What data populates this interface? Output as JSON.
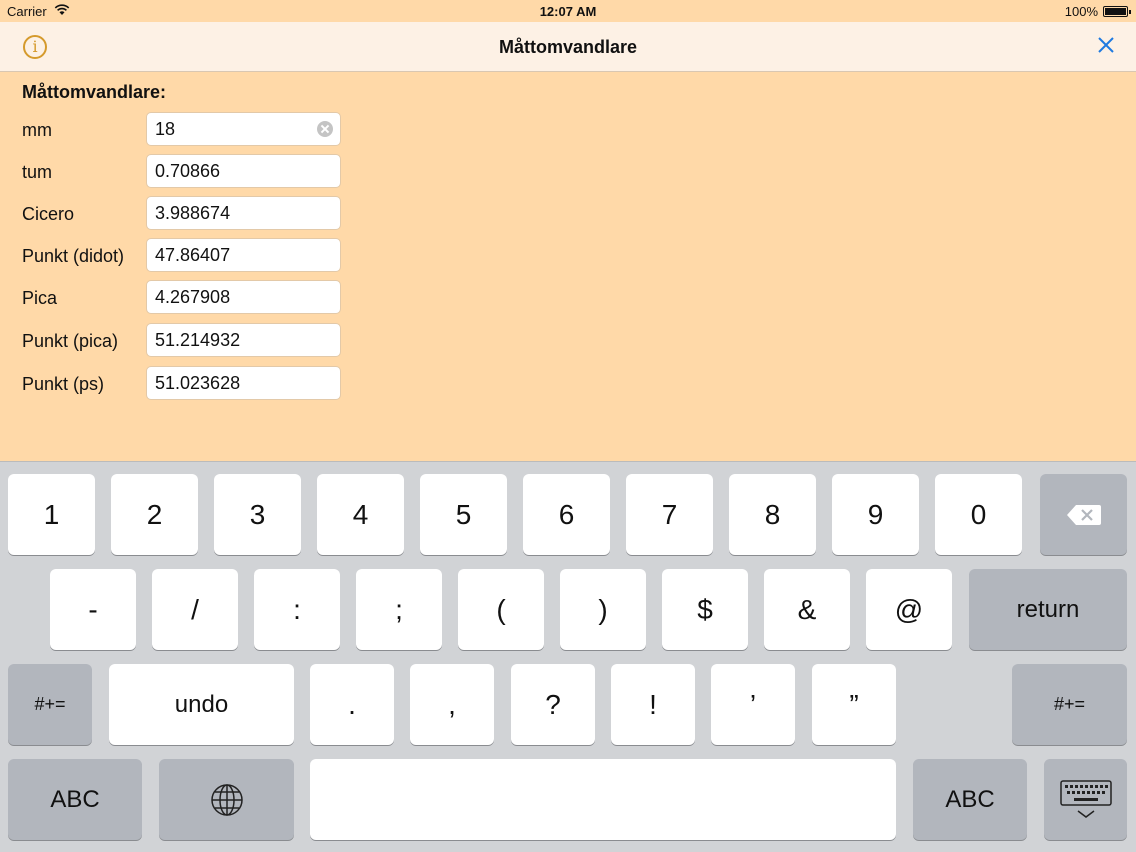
{
  "status_bar": {
    "carrier": "Carrier",
    "time": "12:07 AM",
    "battery": "100%"
  },
  "nav": {
    "title": "Måttomvandlare",
    "info_icon": "info-icon",
    "close_icon": "close-icon"
  },
  "form": {
    "title": "Måttomvandlare:",
    "rows": [
      {
        "label": "mm",
        "value": "18"
      },
      {
        "label": "tum",
        "value": "0.70866"
      },
      {
        "label": "Cicero",
        "value": "3.988674"
      },
      {
        "label": "Punkt (didot)",
        "value": "47.86407"
      },
      {
        "label": "Pica",
        "value": "4.267908"
      },
      {
        "label": "Punkt (pica)",
        "value": "51.214932"
      },
      {
        "label": "Punkt (ps)",
        "value": "51.023628"
      }
    ]
  },
  "keyboard": {
    "row1": [
      "1",
      "2",
      "3",
      "4",
      "5",
      "6",
      "7",
      "8",
      "9",
      "0"
    ],
    "row2": [
      "-",
      "/",
      ":",
      ";",
      "(",
      ")",
      "$",
      "&",
      "@"
    ],
    "return_label": "return",
    "row3": [
      ".",
      ",",
      "?",
      "!",
      "’",
      "”"
    ],
    "symbols_label": "#+=",
    "undo_label": "undo",
    "abc_label": "ABC",
    "icons": {
      "backspace": "backspace-icon",
      "globe": "globe-icon",
      "dismiss": "keyboard-dismiss-icon"
    }
  },
  "colors": {
    "background": "#ffd9a8",
    "navbar": "#fdf1e5",
    "accent": "#d59a2c",
    "close": "#1f7ae0"
  }
}
